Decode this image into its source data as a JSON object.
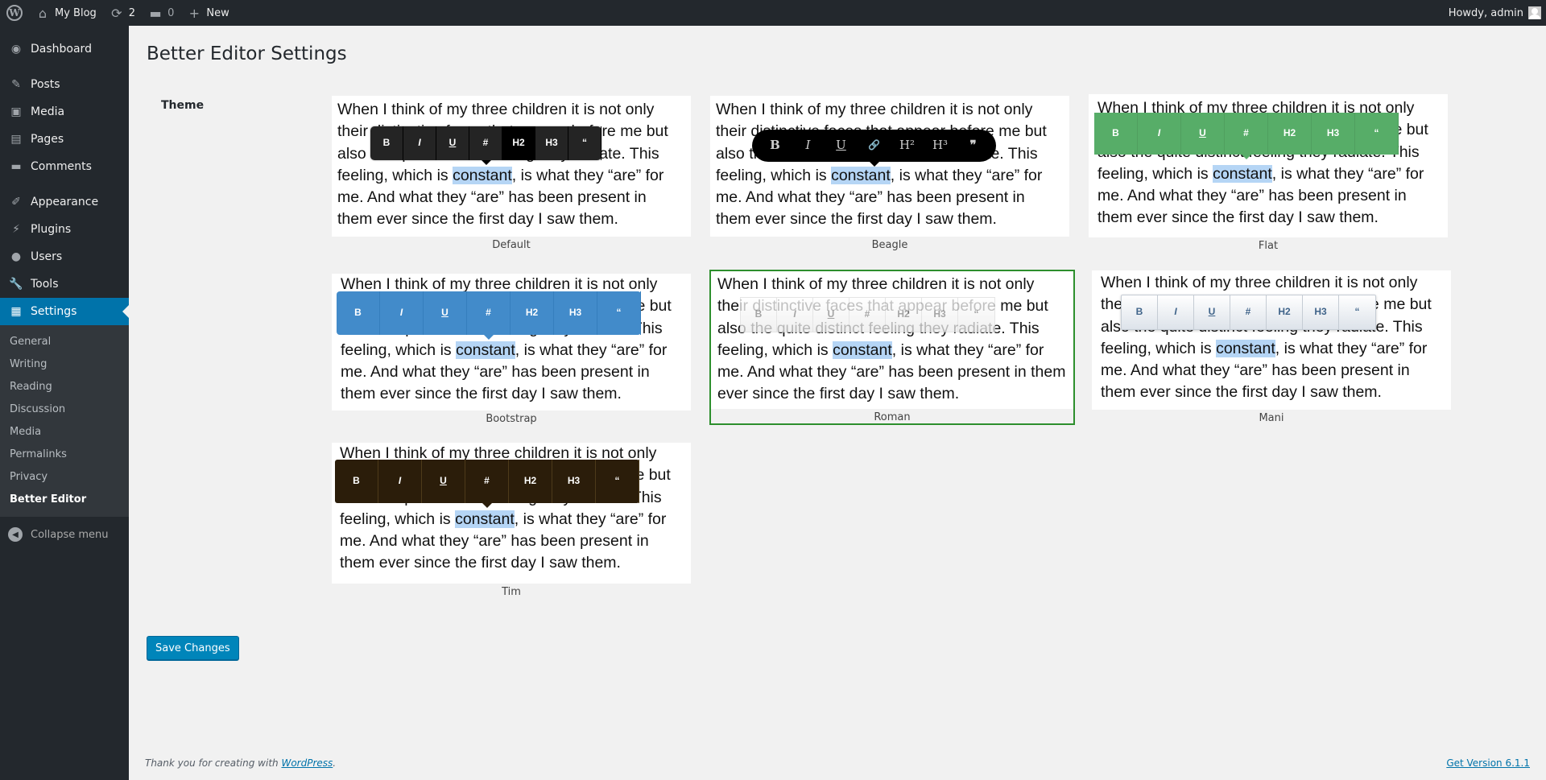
{
  "adminbar": {
    "site_name": "My Blog",
    "updates_count": "2",
    "comments_count": "0",
    "new_label": "New",
    "greeting": "Howdy, admin"
  },
  "sidebar": {
    "items": [
      {
        "label": "Dashboard",
        "icon": "dashboard-icon"
      },
      {
        "label": "Posts",
        "icon": "pin-icon"
      },
      {
        "label": "Media",
        "icon": "media-icon"
      },
      {
        "label": "Pages",
        "icon": "pages-icon"
      },
      {
        "label": "Comments",
        "icon": "comments-icon"
      },
      {
        "label": "Appearance",
        "icon": "brush-icon"
      },
      {
        "label": "Plugins",
        "icon": "plug-icon"
      },
      {
        "label": "Users",
        "icon": "user-icon"
      },
      {
        "label": "Tools",
        "icon": "wrench-icon"
      },
      {
        "label": "Settings",
        "icon": "settings-icon"
      }
    ],
    "submenu": [
      "General",
      "Writing",
      "Reading",
      "Discussion",
      "Media",
      "Permalinks",
      "Privacy",
      "Better Editor"
    ],
    "collapse_label": "Collapse menu"
  },
  "page": {
    "title": "Better Editor Settings",
    "theme_label": "Theme",
    "sample_text_before": "When I think of my three children it is not only their distinctive faces that appear before me but also the quite distinct feeling they radiate. This feeling, which is ",
    "sample_highlight": "constant",
    "sample_text_after": ", is what they “are” for me. And what they “are” has been present in them ever since the first day I saw them.",
    "themes": [
      {
        "name": "Default"
      },
      {
        "name": "Beagle"
      },
      {
        "name": "Flat"
      },
      {
        "name": "Bootstrap"
      },
      {
        "name": "Roman"
      },
      {
        "name": "Mani"
      },
      {
        "name": "Tim"
      }
    ],
    "selected_theme": "Roman",
    "toolbar_buttons": [
      "B",
      "I",
      "U",
      "#",
      "H2",
      "H3",
      "“"
    ],
    "beagle_buttons": [
      "B",
      "I",
      "U",
      "🔗",
      "H²",
      "H³",
      "❞"
    ],
    "save_label": "Save Changes"
  },
  "footer": {
    "thanks_prefix": "Thank you for creating with ",
    "wordpress_link": "WordPress",
    "thanks_suffix": ".",
    "version": "Get Version 6.1.1"
  },
  "colors": {
    "accent": "#0073aa",
    "selected_outline": "#2d8f2d"
  }
}
